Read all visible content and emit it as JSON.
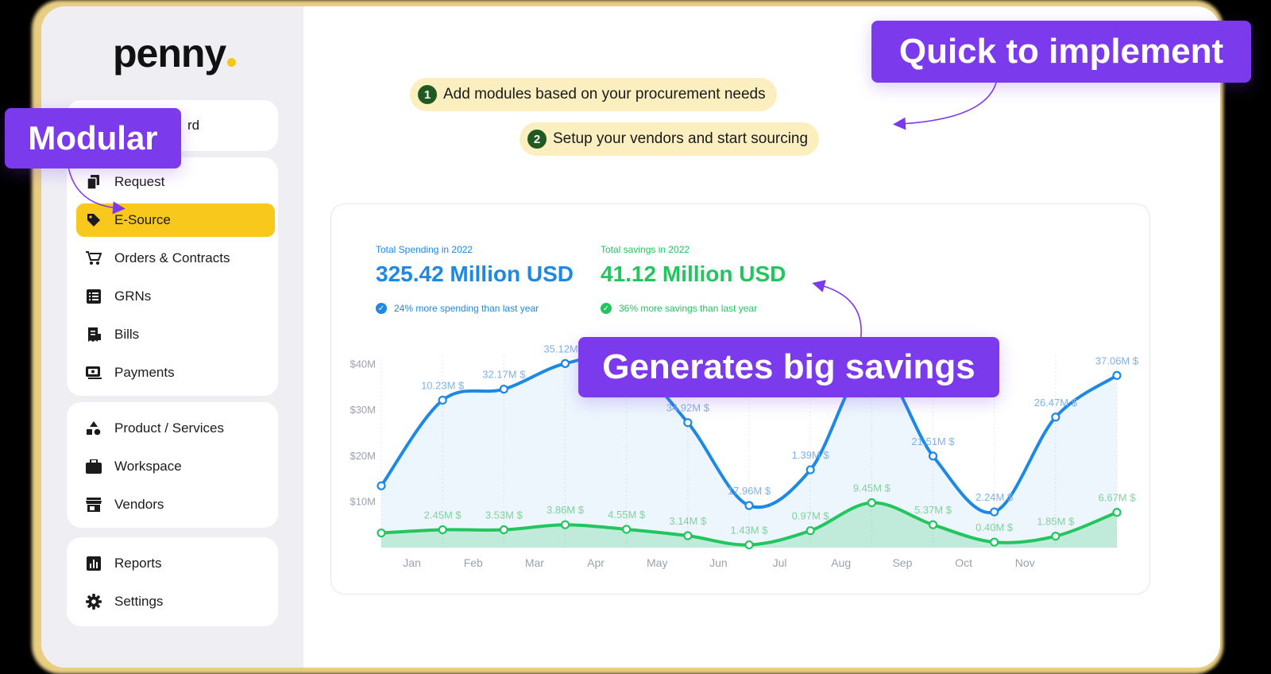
{
  "brand": {
    "name": "penny"
  },
  "callouts": {
    "modular": "Modular",
    "quick": "Quick to implement",
    "savings": "Generates big savings"
  },
  "sidebar": {
    "top_item_partial": "rd",
    "group1": [
      {
        "label": "Request",
        "icon": "document-copy-icon"
      },
      {
        "label": "E-Source",
        "icon": "tag-icon",
        "active": true
      },
      {
        "label": "Orders & Contracts",
        "icon": "cart-icon"
      },
      {
        "label": "GRNs",
        "icon": "list-icon"
      },
      {
        "label": "Bills",
        "icon": "receipt-icon"
      },
      {
        "label": "Payments",
        "icon": "payment-icon"
      }
    ],
    "group2": [
      {
        "label": "Product / Services",
        "icon": "shapes-icon"
      },
      {
        "label": "Workspace",
        "icon": "briefcase-icon"
      },
      {
        "label": "Vendors",
        "icon": "store-icon"
      }
    ],
    "group3": [
      {
        "label": "Reports",
        "icon": "bar-chart-icon"
      },
      {
        "label": "Settings",
        "icon": "gear-icon"
      }
    ],
    "accent": "#f8c81c"
  },
  "steps": [
    {
      "num": "1",
      "text": "Add modules based on your procurement needs"
    },
    {
      "num": "2",
      "text": "Setup your vendors and start sourcing"
    }
  ],
  "stats": {
    "spending": {
      "label": "Total Spending in 2022",
      "value": "325.42 Million USD",
      "note": "24% more spending than last year",
      "color": "#1e88e5"
    },
    "savings": {
      "label": "Total savings in 2022",
      "value": "41.12 Million USD",
      "note": "36% more savings than last year",
      "color": "#22c55e"
    }
  },
  "chart_data": {
    "type": "area",
    "y_ticks": [
      "$10M",
      "$20M",
      "$30M",
      "$40M"
    ],
    "x_ticks": [
      "Jan",
      "Feb",
      "Mar",
      "Apr",
      "May",
      "Jun",
      "Jul",
      "Aug",
      "Sep",
      "Oct",
      "Nov"
    ],
    "ylim": [
      0,
      42
    ],
    "series": [
      {
        "color": "#1e88e5",
        "points": [
          {
            "y": 13.5,
            "label": ""
          },
          {
            "y": 32.2,
            "label": "10.23M $"
          },
          {
            "y": 34.6,
            "label": "32.17M $"
          },
          {
            "y": 40.2,
            "label": "35.12M $"
          },
          {
            "y": 41.0,
            "label": ""
          },
          {
            "y": 27.3,
            "label": "34.92M $"
          },
          {
            "y": 9.2,
            "label": "17.96M $"
          },
          {
            "y": 17.0,
            "label": "1.39M $"
          },
          {
            "y": 41.0,
            "label": ""
          },
          {
            "y": 20.0,
            "label": "21.51M $"
          },
          {
            "y": 7.8,
            "label": "2.24M $"
          },
          {
            "y": 28.5,
            "label": "26.47M $"
          },
          {
            "y": 37.6,
            "label": "37.06M $"
          }
        ]
      },
      {
        "color": "#22c55e",
        "points": [
          {
            "y": 3.2,
            "label": ""
          },
          {
            "y": 3.9,
            "label": "2.45M $"
          },
          {
            "y": 3.9,
            "label": "3.53M $"
          },
          {
            "y": 5.0,
            "label": "3.86M $"
          },
          {
            "y": 4.0,
            "label": "4.55M $"
          },
          {
            "y": 2.6,
            "label": "3.14M $"
          },
          {
            "y": 0.6,
            "label": "1.43M $"
          },
          {
            "y": 3.7,
            "label": "0.97M $"
          },
          {
            "y": 9.8,
            "label": "9.45M $"
          },
          {
            "y": 5.0,
            "label": "5.37M $"
          },
          {
            "y": 1.2,
            "label": "0.40M $"
          },
          {
            "y": 2.5,
            "label": "1.85M $"
          },
          {
            "y": 7.7,
            "label": "6.67M $"
          }
        ]
      }
    ]
  }
}
